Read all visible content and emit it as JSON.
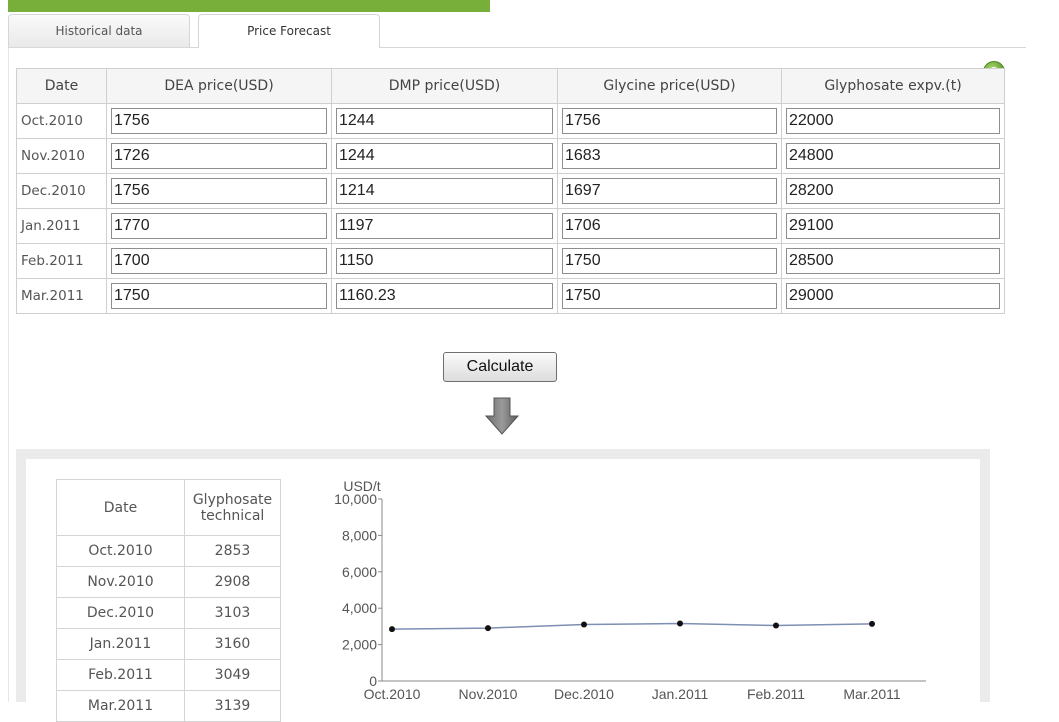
{
  "tabs": [
    {
      "label": "Historical data"
    },
    {
      "label": "Price Forecast"
    }
  ],
  "input_table": {
    "headers": [
      "Date",
      "DEA price(USD)",
      "DMP price(USD)",
      "Glycine price(USD)",
      "Glyphosate expv.(t)"
    ],
    "rows": [
      {
        "date": "Oct.2010",
        "dea": "1756",
        "dmp": "1244",
        "glycine": "1756",
        "expv": "22000"
      },
      {
        "date": "Nov.2010",
        "dea": "1726",
        "dmp": "1244",
        "glycine": "1683",
        "expv": "24800"
      },
      {
        "date": "Dec.2010",
        "dea": "1756",
        "dmp": "1214",
        "glycine": "1697",
        "expv": "28200"
      },
      {
        "date": "Jan.2011",
        "dea": "1770",
        "dmp": "1197",
        "glycine": "1706",
        "expv": "29100"
      },
      {
        "date": "Feb.2011",
        "dea": "1700",
        "dmp": "1150",
        "glycine": "1750",
        "expv": "28500"
      },
      {
        "date": "Mar.2011",
        "dea": "1750",
        "dmp": "1160.23",
        "glycine": "1750",
        "expv": "29000"
      }
    ]
  },
  "calculate_label": "Calculate",
  "result_table": {
    "headers": [
      "Date",
      "Glyphosate technical"
    ],
    "rows": [
      {
        "date": "Oct.2010",
        "value": "2853"
      },
      {
        "date": "Nov.2010",
        "value": "2908"
      },
      {
        "date": "Dec.2010",
        "value": "3103"
      },
      {
        "date": "Jan.2011",
        "value": "3160"
      },
      {
        "date": "Feb.2011",
        "value": "3049"
      },
      {
        "date": "Mar.2011",
        "value": "3139"
      }
    ]
  },
  "chart_data": {
    "type": "line",
    "title": "",
    "ylabel": "USD/t",
    "xlabel": "",
    "categories": [
      "Oct.2010",
      "Nov.2010",
      "Dec.2010",
      "Jan.2011",
      "Feb.2011",
      "Mar.2011"
    ],
    "values": [
      2853,
      2908,
      3103,
      3160,
      3049,
      3139
    ],
    "ylim": [
      0,
      10000
    ],
    "yticks": [
      0,
      2000,
      4000,
      6000,
      8000,
      10000
    ],
    "ytick_labels": [
      "0",
      "2,000",
      "4,000",
      "6,000",
      "8,000",
      "10,000"
    ],
    "line_color": "#7d8fb3",
    "marker_color": "#111111",
    "grid": false,
    "legend": "none"
  },
  "colors": {
    "brand_green": "#78ae3a",
    "help_green": "#6aa32f"
  },
  "icons": {
    "help": "help-icon",
    "arrow": "down-arrow-icon"
  }
}
